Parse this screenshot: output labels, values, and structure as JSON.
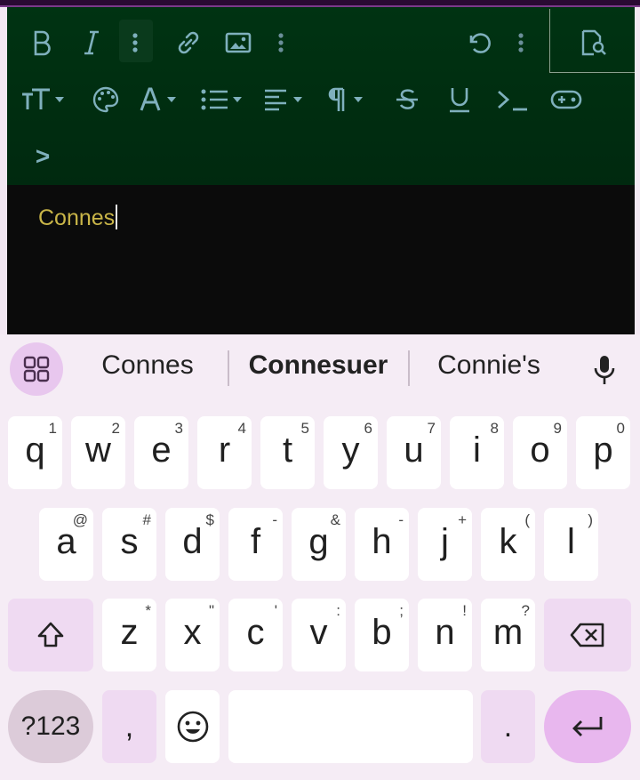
{
  "editor": {
    "toolbar": {
      "row1": [
        "bold-icon",
        "italic-icon",
        "more-vert-icon",
        "link-icon",
        "image-icon",
        "more-vert-icon",
        "undo-icon",
        "more-vert-icon",
        "preview-search-icon"
      ],
      "row2": [
        "text-size-icon",
        "palette-icon",
        "font-color-icon",
        "bullet-list-icon",
        "align-icon",
        "paragraph-icon",
        "strikethrough-icon",
        "underline-icon",
        "terminal-icon",
        "gamepad-icon"
      ],
      "row3_label": ">"
    },
    "content": {
      "text": "Connes"
    },
    "colors": {
      "toolbar_bg": "#003312",
      "icon": "#7fb0bd",
      "text": "#c9b548",
      "content_bg": "#0b0b0b"
    }
  },
  "keyboard": {
    "suggestions": [
      "Connes",
      "Connesuer",
      "Connie's"
    ],
    "rows": [
      [
        [
          "q",
          "1"
        ],
        [
          "w",
          "2"
        ],
        [
          "e",
          "3"
        ],
        [
          "r",
          "4"
        ],
        [
          "t",
          "5"
        ],
        [
          "y",
          "6"
        ],
        [
          "u",
          "7"
        ],
        [
          "i",
          "8"
        ],
        [
          "o",
          "9"
        ],
        [
          "p",
          "0"
        ]
      ],
      [
        [
          "a",
          "@"
        ],
        [
          "s",
          "#"
        ],
        [
          "d",
          "$"
        ],
        [
          "f",
          "-"
        ],
        [
          "g",
          "&"
        ],
        [
          "h",
          "-"
        ],
        [
          "j",
          "+"
        ],
        [
          "k",
          "("
        ],
        [
          "l",
          ")"
        ]
      ],
      [
        [
          "z",
          "*"
        ],
        [
          "x",
          "\""
        ],
        [
          "c",
          "'"
        ],
        [
          "v",
          ":"
        ],
        [
          "b",
          ";"
        ],
        [
          "n",
          "!"
        ],
        [
          "m",
          "?"
        ]
      ]
    ],
    "symbols_label": "?123",
    "comma_label": ",",
    "period_label": ".",
    "colors": {
      "bg": "#f5ecf5",
      "key": "#ffffff",
      "mod": "#efdaf2",
      "enter": "#e8b7ee"
    }
  }
}
